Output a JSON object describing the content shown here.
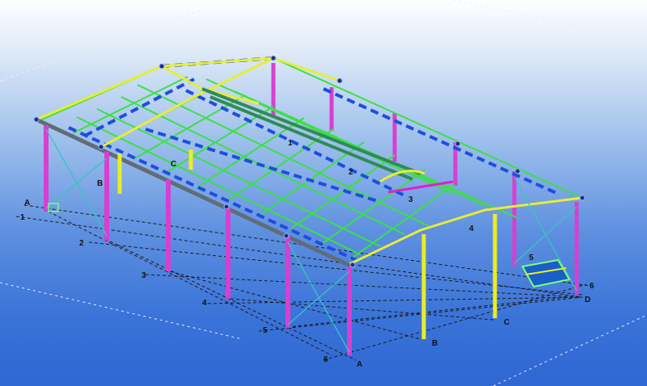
{
  "model_view": {
    "grid_labels_lower_left": [
      "A",
      "1",
      "B",
      "2",
      "C",
      "3",
      "4",
      "5",
      "6"
    ],
    "grid_labels_front": [
      "A",
      "B",
      "C",
      "D",
      "6"
    ],
    "grid_labels_far_side": [
      "1",
      "2",
      "3",
      "4",
      "5"
    ],
    "colors": {
      "column": "#d83fd0",
      "yellow_column": "#ecec25",
      "rafter": "#e7ee34",
      "purlin": "#3be046",
      "bracing": "#1c4ee0",
      "eave_beam": "#606c78",
      "cross_brace": "#38c4c0"
    }
  }
}
